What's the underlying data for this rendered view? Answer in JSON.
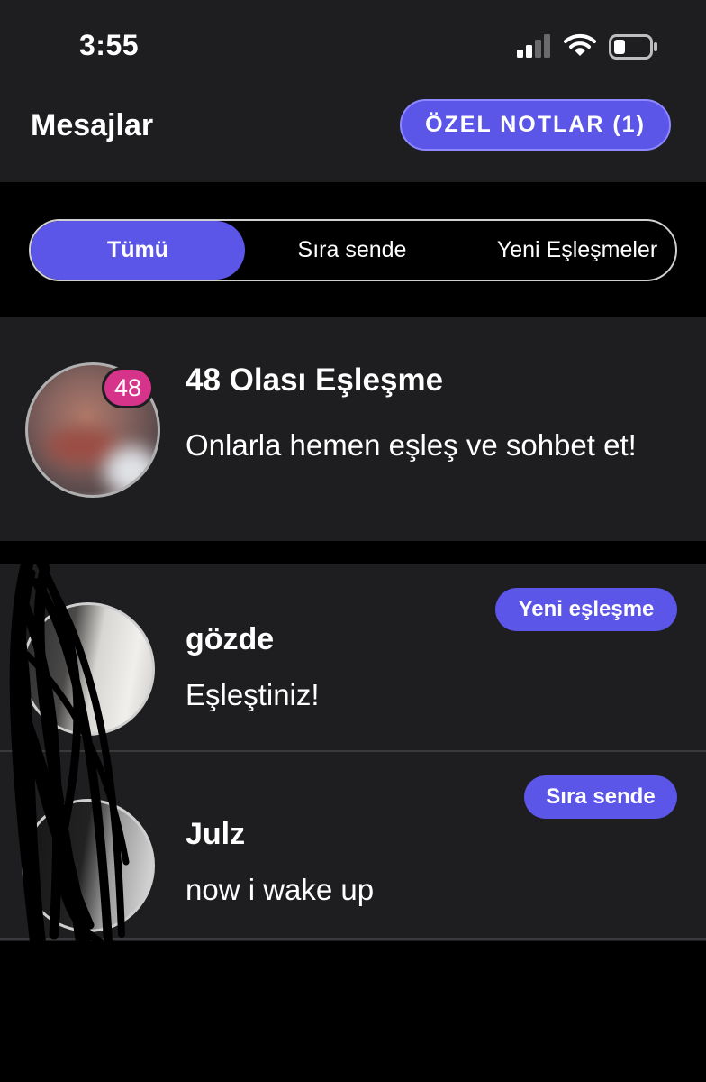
{
  "status_bar": {
    "time": "3:55",
    "icons": [
      "cellular-signal-icon",
      "wifi-icon",
      "battery-icon"
    ]
  },
  "header": {
    "title": "Mesajlar",
    "notes_button_label": "ÖZEL NOTLAR (1)"
  },
  "tabs": [
    {
      "label": "Tümü",
      "active": true
    },
    {
      "label": "Sıra sende",
      "active": false
    },
    {
      "label": "Yeni Eşleşmeler",
      "active": false
    }
  ],
  "potential_matches": {
    "count_badge": "48",
    "title": "48 Olası Eşleşme",
    "subtitle": "Onlarla hemen eşleş ve sohbet et!"
  },
  "conversations": [
    {
      "name": "gözde",
      "preview": "Eşleştiniz!",
      "badge": "Yeni eşleşme"
    },
    {
      "name": "Julz",
      "preview": "now i wake up",
      "badge": "Sıra sende"
    }
  ],
  "colors": {
    "accent": "#5b55e8",
    "badge_pink": "#d6338a",
    "card_background": "#1e1e20",
    "page_background": "#000000"
  }
}
